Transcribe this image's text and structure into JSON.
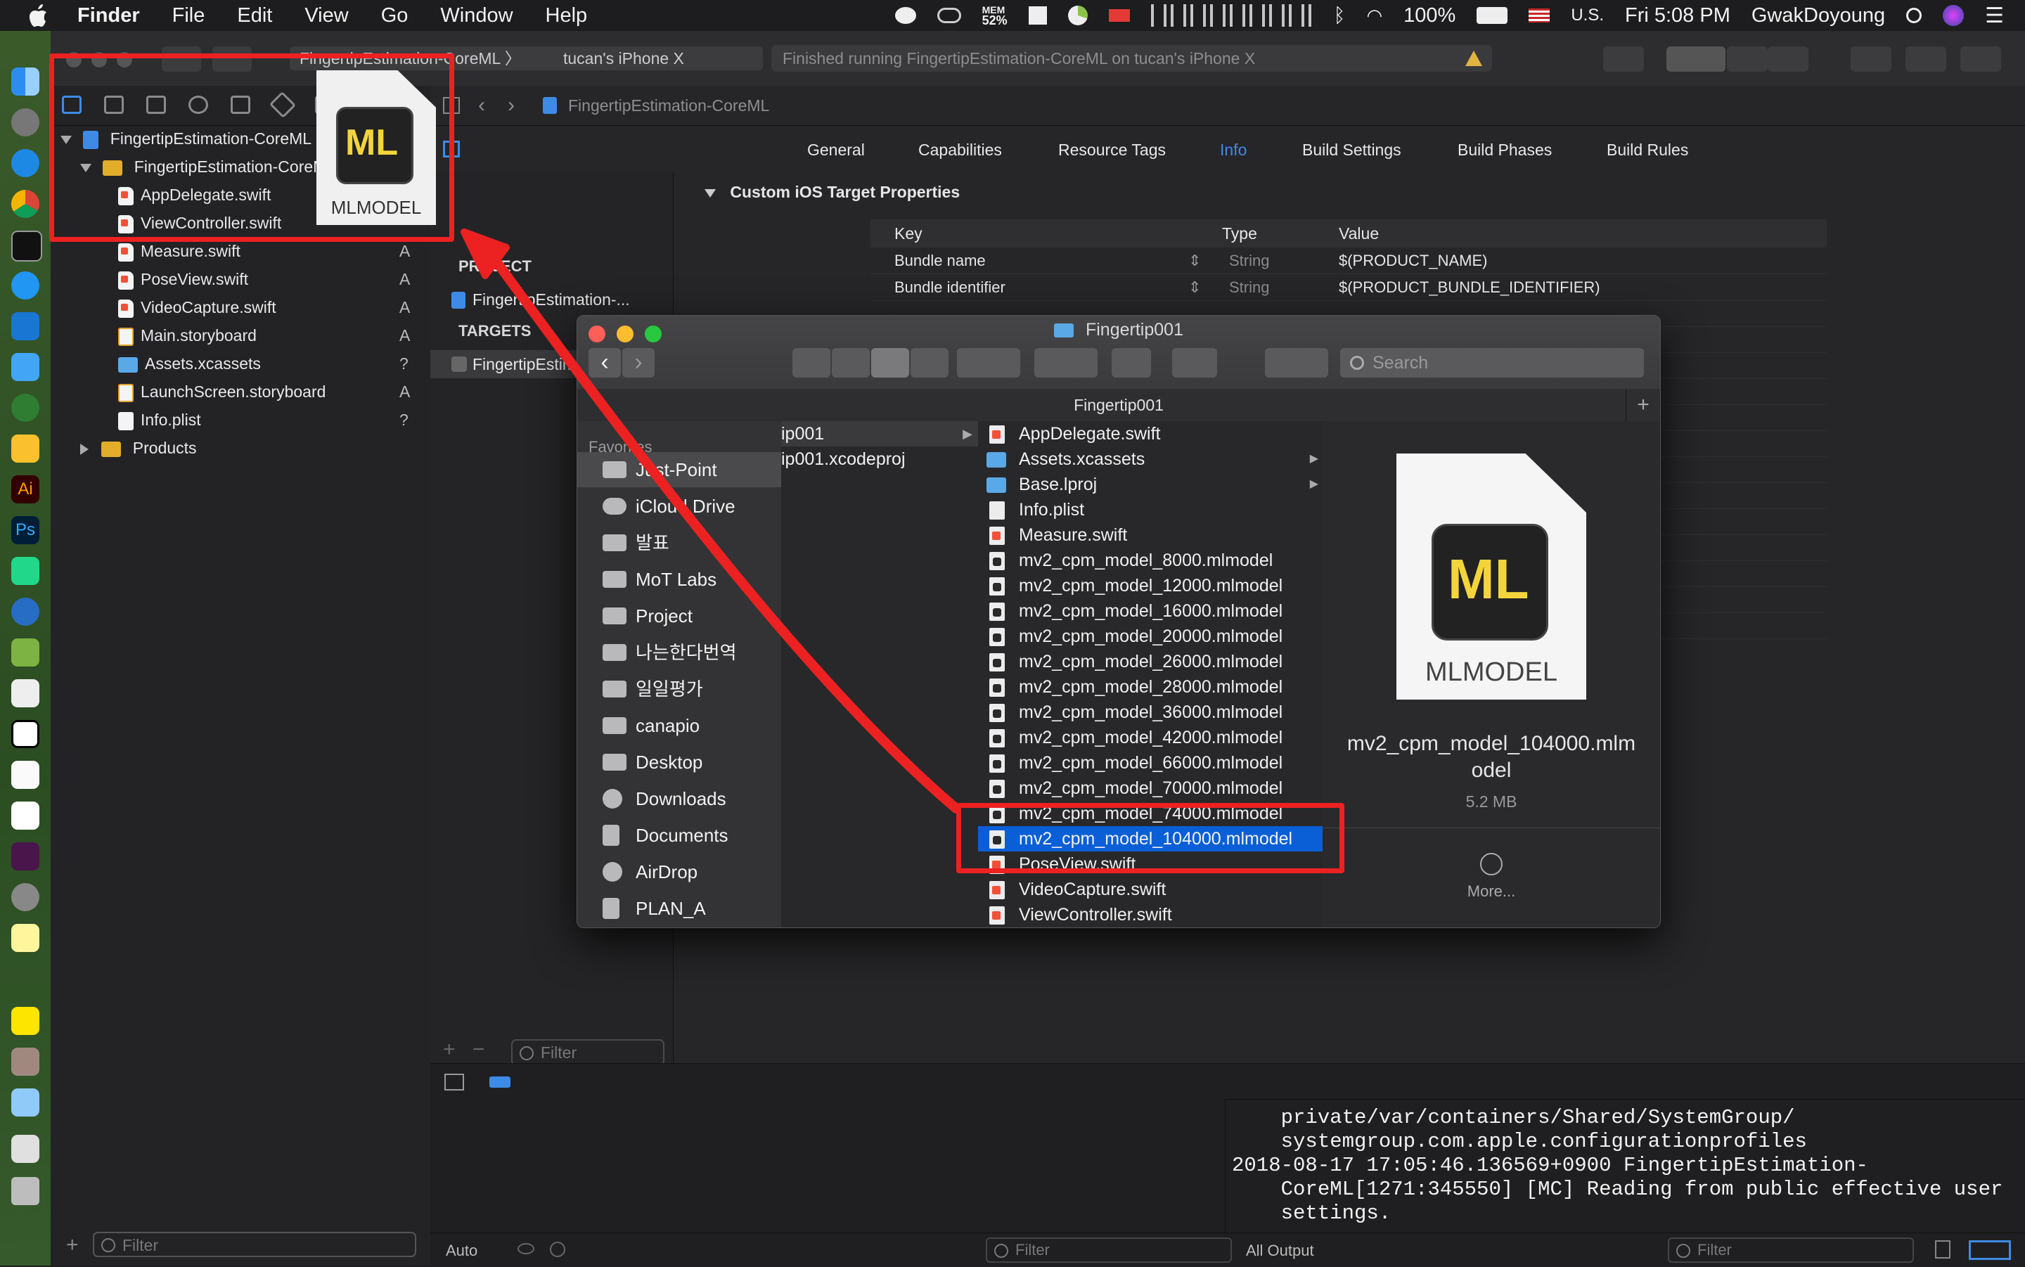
{
  "menubar": {
    "app_name": "Finder",
    "items": [
      "File",
      "Edit",
      "View",
      "Go",
      "Window",
      "Help"
    ],
    "mem_label": "MEM",
    "mem_value": "52%",
    "battery": "100%",
    "input_source": "U.S.",
    "datetime": "Fri 5:08 PM",
    "user": "GwakDoyoung"
  },
  "xcode": {
    "scheme_target": "FingertipEstimation-CoreML",
    "device": "tucan's iPhone X",
    "status_text": "Finished running FingertipEstimation-CoreML on tucan's iPhone X",
    "jumpbar_project": "FingertipEstimation-CoreML",
    "tabs": [
      "General",
      "Capabilities",
      "Resource Tags",
      "Info",
      "Build Settings",
      "Build Phases",
      "Build Rules"
    ],
    "active_tab": "Info",
    "navigator": {
      "project": "FingertipEstimation-CoreML",
      "group": "FingertipEstimation-CoreML",
      "files": [
        {
          "name": "AppDelegate.swift",
          "badge": ""
        },
        {
          "name": "ViewController.swift",
          "badge": ""
        },
        {
          "name": "Measure.swift",
          "badge": "A"
        },
        {
          "name": "PoseView.swift",
          "badge": "A"
        },
        {
          "name": "VideoCapture.swift",
          "badge": "A"
        },
        {
          "name": "Main.storyboard",
          "badge": "A"
        },
        {
          "name": "Assets.xcassets",
          "badge": "?"
        },
        {
          "name": "LaunchScreen.storyboard",
          "badge": "A"
        },
        {
          "name": "Info.plist",
          "badge": "?"
        }
      ],
      "products": "Products",
      "filter_placeholder": "Filter"
    },
    "targets_panel": {
      "project_header": "PROJECT",
      "project_item": "FingertipEstimation-...",
      "targets_header": "TARGETS",
      "target_item": "FingertipEstimation-...",
      "filter_placeholder": "Filter"
    },
    "plist": {
      "section_title": "Custom iOS Target Properties",
      "columns": [
        "Key",
        "Type",
        "Value"
      ],
      "rows": [
        {
          "key": "Bundle name",
          "type": "String",
          "value": "$(PRODUCT_NAME)"
        },
        {
          "key": "Bundle identifier",
          "type": "String",
          "value": "$(PRODUCT_BUNDLE_IDENTIFIER)"
        }
      ]
    },
    "debug": {
      "console_lines": [
        "    private/var/containers/Shared/SystemGroup/",
        "    systemgroup.com.apple.configurationprofiles",
        "2018-08-17 17:05:46.136569+0900 FingertipEstimation-",
        "    CoreML[1271:345550] [MC] Reading from public effective user",
        "    settings."
      ],
      "auto_label": "Auto",
      "output_label": "All Output",
      "filter_left": "Filter",
      "filter_right": "Filter"
    }
  },
  "drag_icon": {
    "badge": "ML",
    "label": "MLMODEL"
  },
  "finder": {
    "title": "Fingertip001",
    "search_placeholder": "Search",
    "path_title": "Fingertip001",
    "favorites_header": "Favorites",
    "sidebar": [
      "Just-Point",
      "iCloud Drive",
      "발표",
      "MoT Labs",
      "Project",
      "나는한다번역",
      "일일평가",
      "canapio",
      "Desktop",
      "Downloads",
      "Documents",
      "AirDrop",
      "PLAN_A"
    ],
    "col1": [
      "ip001",
      "ip001.xcodeproj"
    ],
    "files": [
      {
        "name": "AppDelegate.swift",
        "kind": "sw"
      },
      {
        "name": "Assets.xcassets",
        "kind": "folder"
      },
      {
        "name": "Base.lproj",
        "kind": "folder"
      },
      {
        "name": "Info.plist",
        "kind": "plist"
      },
      {
        "name": "Measure.swift",
        "kind": "sw"
      },
      {
        "name": "mv2_cpm_model_8000.mlmodel",
        "kind": "ml"
      },
      {
        "name": "mv2_cpm_model_12000.mlmodel",
        "kind": "ml"
      },
      {
        "name": "mv2_cpm_model_16000.mlmodel",
        "kind": "ml"
      },
      {
        "name": "mv2_cpm_model_20000.mlmodel",
        "kind": "ml"
      },
      {
        "name": "mv2_cpm_model_26000.mlmodel",
        "kind": "ml"
      },
      {
        "name": "mv2_cpm_model_28000.mlmodel",
        "kind": "ml"
      },
      {
        "name": "mv2_cpm_model_36000.mlmodel",
        "kind": "ml"
      },
      {
        "name": "mv2_cpm_model_42000.mlmodel",
        "kind": "ml"
      },
      {
        "name": "mv2_cpm_model_66000.mlmodel",
        "kind": "ml"
      },
      {
        "name": "mv2_cpm_model_70000.mlmodel",
        "kind": "ml"
      },
      {
        "name": "mv2_cpm_model_74000.mlmodel",
        "kind": "ml"
      },
      {
        "name": "mv2_cpm_model_104000.mlmodel",
        "kind": "ml"
      },
      {
        "name": "PoseView.swift",
        "kind": "sw"
      },
      {
        "name": "VideoCapture.swift",
        "kind": "sw"
      },
      {
        "name": "ViewController.swift",
        "kind": "sw"
      }
    ],
    "selected_file": "mv2_cpm_model_104000.mlmodel",
    "preview": {
      "badge": "ML",
      "label": "MLMODEL",
      "name_line1": "mv2_cpm_model_104000.mlm",
      "name_line2": "odel",
      "size": "5.2 MB",
      "more": "More..."
    }
  },
  "colors": {
    "annotation_red": "#ec2121",
    "selection_blue": "#0a5fd6",
    "ml_yellow": "#f3d53b"
  }
}
